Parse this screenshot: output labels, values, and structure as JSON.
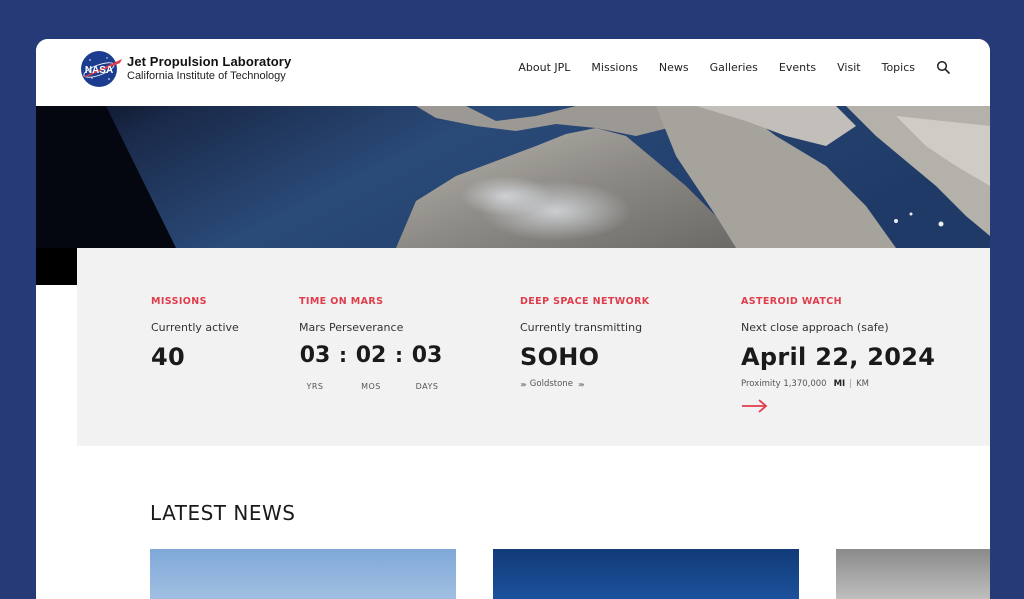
{
  "header": {
    "logo_icon": "nasa-meatball-logo",
    "logo_text": "NASA",
    "title": "Jet Propulsion Laboratory",
    "subtitle": "California Institute of Technology",
    "nav": [
      "About JPL",
      "Missions",
      "News",
      "Galleries",
      "Events",
      "Visit",
      "Topics"
    ],
    "search_icon": "search-icon"
  },
  "hero": {
    "description_icon": "aerial-coastline-image"
  },
  "stats": {
    "missions": {
      "label": "MISSIONS",
      "desc": "Currently active",
      "value": "40"
    },
    "mars": {
      "label": "TIME ON MARS",
      "desc": "Mars Perseverance",
      "years": "03",
      "months": "02",
      "days": "03",
      "sep": ":",
      "unit_years": "YRS",
      "unit_months": "MOS",
      "unit_days": "DAYS"
    },
    "dsn": {
      "label": "DEEP SPACE NETWORK",
      "desc": "Currently transmitting",
      "value": "SOHO",
      "station": "Goldstone"
    },
    "asteroid": {
      "label": "ASTEROID WATCH",
      "desc": "Next close approach (safe)",
      "value": "April 22, 2024",
      "proximity": "Proximity 1,370,000",
      "unit_mi": "MI",
      "unit_divider": "|",
      "unit_km": "KM",
      "arrow_icon": "arrow-right-icon"
    }
  },
  "news": {
    "title": "LATEST NEWS"
  },
  "colors": {
    "background": "#263a78",
    "accent": "#e03c4b",
    "panel": "#f2f2f2"
  }
}
